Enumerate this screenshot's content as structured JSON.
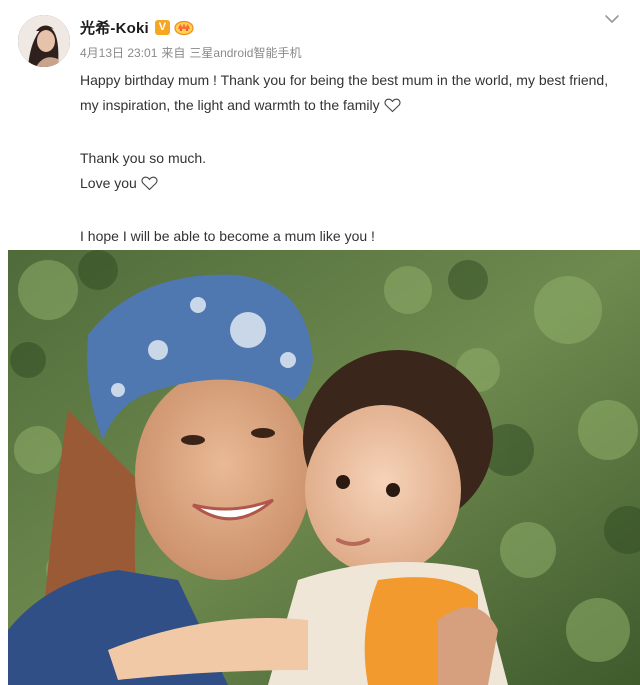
{
  "post": {
    "author": {
      "name": "光希-Koki",
      "verified_badge": "V",
      "avatar_icon": "avatar-portrait"
    },
    "meta": {
      "date": "4月13日 23:01",
      "source_prefix": "来自",
      "source": "三星android智能手机"
    },
    "text": {
      "line1": "Happy birthday mum ! Thank you for being the best mum in the world, my best friend, my inspiration, the light and warmth to the family",
      "line2": "Thank you so much.",
      "line3": "Love you",
      "line4": "I hope I will be able to become a mum like you !"
    },
    "icons": {
      "heart": "heart-outline-icon",
      "menu": "chevron-down-icon",
      "vip": "vip-crown-icon"
    },
    "colors": {
      "verified": "#f5a623",
      "username": "#1a1a1a",
      "meta": "#8a8a8a"
    }
  }
}
